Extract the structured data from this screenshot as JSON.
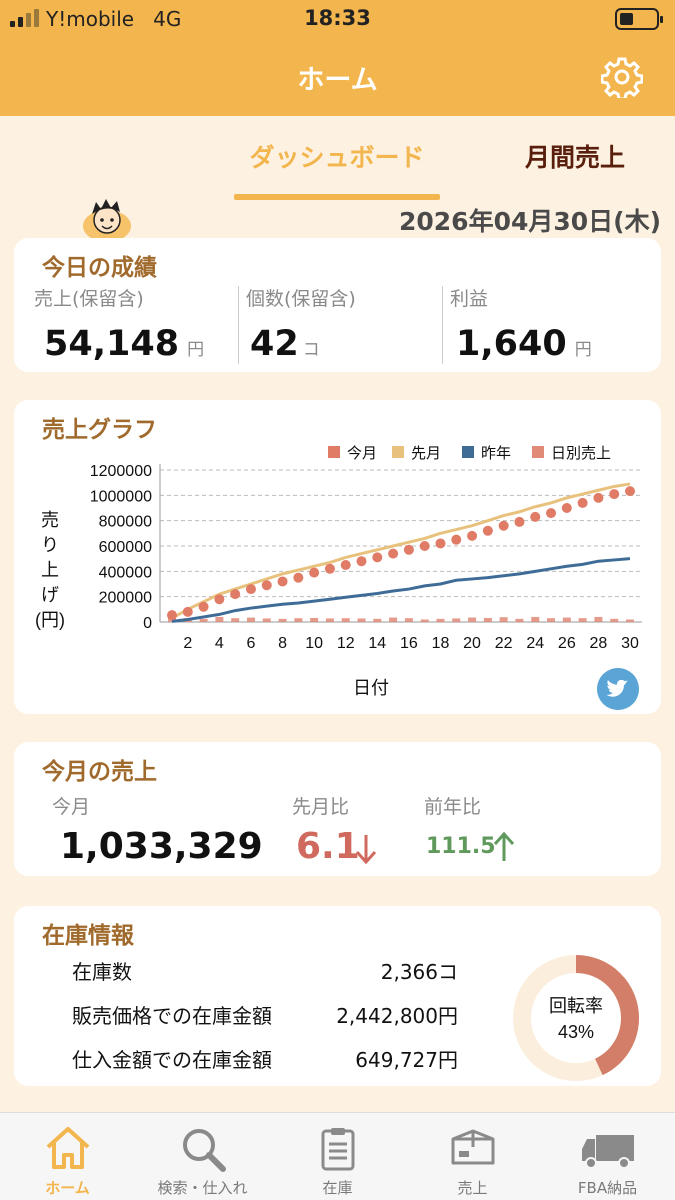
{
  "status_bar": {
    "carrier": "Y!mobile",
    "network": "4G",
    "time": "18:33"
  },
  "header": {
    "title": "ホーム"
  },
  "tabs": [
    {
      "label": "ダッシュボード",
      "active": true
    },
    {
      "label": "月間売上",
      "active": false
    }
  ],
  "date": "2026年04月30日(木)",
  "today": {
    "title": "今日の成績",
    "sales": {
      "label": "売上(保留含)",
      "value": "54,148",
      "unit": "円"
    },
    "count": {
      "label": "個数(保留含)",
      "value": "42",
      "unit": "コ"
    },
    "profit": {
      "label": "利益",
      "value": "1,640",
      "unit": "円"
    }
  },
  "graph": {
    "title": "売上グラフ",
    "legend": [
      "今月",
      "先月",
      "昨年",
      "日別売上"
    ],
    "colors": {
      "this_month": "#e07b66",
      "last_month": "#e8c27c",
      "last_year": "#3f6c97",
      "daily": "#e08a78"
    }
  },
  "chart_data": {
    "type": "line",
    "x": [
      1,
      2,
      3,
      4,
      5,
      6,
      7,
      8,
      9,
      10,
      11,
      12,
      13,
      14,
      15,
      16,
      17,
      18,
      19,
      20,
      21,
      22,
      23,
      24,
      25,
      26,
      27,
      28,
      29,
      30
    ],
    "x_ticks": [
      "2",
      "4",
      "6",
      "8",
      "10",
      "12",
      "14",
      "16",
      "18",
      "20",
      "22",
      "24",
      "26",
      "28",
      "30"
    ],
    "y_ticks": [
      "1200000",
      "1000000",
      "800000",
      "600000",
      "400000",
      "200000",
      "0"
    ],
    "ylim": [
      0,
      1200000
    ],
    "xlabel": "日付",
    "ylabel": "売り上げ(円)",
    "grid": true,
    "legend_position": "top-right",
    "series": [
      {
        "name": "今月",
        "kind": "points",
        "values": [
          54148,
          80000,
          120000,
          180000,
          220000,
          260000,
          290000,
          320000,
          350000,
          390000,
          420000,
          450000,
          480000,
          510000,
          540000,
          570000,
          600000,
          620000,
          650000,
          680000,
          720000,
          760000,
          790000,
          830000,
          860000,
          900000,
          940000,
          980000,
          1010000,
          1033329
        ]
      },
      {
        "name": "先月",
        "kind": "line",
        "values": [
          30000,
          100000,
          160000,
          220000,
          260000,
          300000,
          340000,
          380000,
          410000,
          440000,
          470000,
          510000,
          540000,
          570000,
          600000,
          630000,
          660000,
          700000,
          730000,
          760000,
          800000,
          840000,
          870000,
          910000,
          940000,
          980000,
          1010000,
          1040000,
          1070000,
          1090000
        ]
      },
      {
        "name": "昨年",
        "kind": "line",
        "values": [
          5000,
          20000,
          40000,
          60000,
          90000,
          110000,
          125000,
          140000,
          150000,
          165000,
          180000,
          195000,
          210000,
          225000,
          245000,
          260000,
          285000,
          300000,
          330000,
          340000,
          350000,
          365000,
          380000,
          400000,
          420000,
          440000,
          455000,
          480000,
          490000,
          500000
        ]
      },
      {
        "name": "日別売上",
        "kind": "bars",
        "values": [
          54148,
          30000,
          25000,
          40000,
          30000,
          35000,
          28000,
          25000,
          30000,
          32000,
          28000,
          30000,
          28000,
          25000,
          35000,
          30000,
          20000,
          25000,
          28000,
          35000,
          32000,
          38000,
          25000,
          40000,
          30000,
          35000,
          30000,
          40000,
          25000,
          20000
        ]
      }
    ]
  },
  "month": {
    "title": "今月の売上",
    "this_month_label": "今月",
    "this_month_value": "1,033,329",
    "mom_label": "先月比",
    "mom_value": "6.1",
    "mom_direction": "down",
    "yoy_label": "前年比",
    "yoy_value": "111.5",
    "yoy_direction": "up"
  },
  "inventory": {
    "title": "在庫情報",
    "rows": [
      {
        "label": "在庫数",
        "value": "2,366コ"
      },
      {
        "label": "販売価格での在庫金額",
        "value": "2,442,800円"
      },
      {
        "label": "仕入金額での在庫金額",
        "value": "649,727円"
      }
    ],
    "turnover_label": "回転率",
    "turnover_value": "43%",
    "turnover_fraction": 0.43
  },
  "bottom_nav": [
    {
      "label": "ホーム",
      "icon": "home-icon",
      "active": true
    },
    {
      "label": "検索・仕入れ",
      "icon": "search-icon",
      "active": false
    },
    {
      "label": "在庫",
      "icon": "clipboard-icon",
      "active": false
    },
    {
      "label": "売上",
      "icon": "box-icon",
      "active": false
    },
    {
      "label": "FBA納品",
      "icon": "truck-icon",
      "active": false
    }
  ]
}
